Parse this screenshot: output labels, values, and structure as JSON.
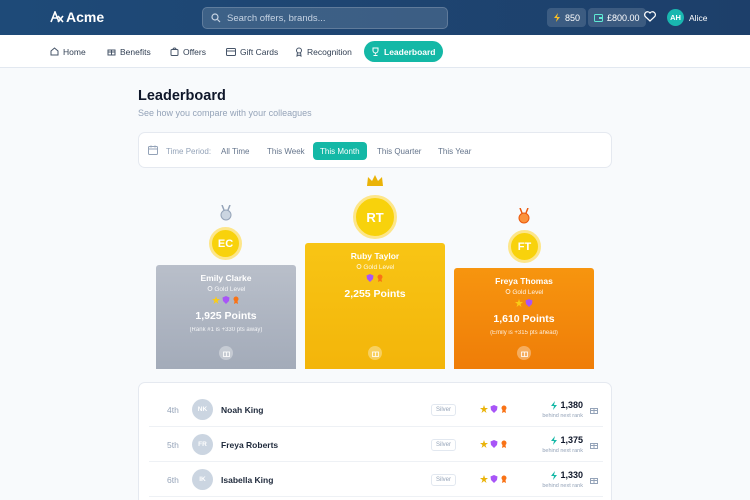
{
  "header": {
    "brand": "Acme",
    "search_placeholder": "Search offers, brands...",
    "points_balance": "850",
    "wallet_balance": "£800.00",
    "user_initials": "AH",
    "user_name": "Alice"
  },
  "nav": {
    "items": [
      {
        "label": "Home",
        "icon": "home-icon"
      },
      {
        "label": "Benefits",
        "icon": "gift-icon"
      },
      {
        "label": "Offers",
        "icon": "shopping-bag-icon"
      },
      {
        "label": "Gift Cards",
        "icon": "card-icon"
      },
      {
        "label": "Recognition",
        "icon": "award-icon"
      },
      {
        "label": "Leaderboard",
        "icon": "trophy-icon",
        "active": true
      }
    ]
  },
  "page": {
    "title": "Leaderboard",
    "subtitle": "See how you compare with your colleagues"
  },
  "filter": {
    "label": "Time Period:",
    "options": [
      "All Time",
      "This Week",
      "This Month",
      "This Quarter",
      "This Year"
    ],
    "selected": "This Month"
  },
  "podium": {
    "first": {
      "initials": "RT",
      "name": "Ruby Taylor",
      "level": "Gold Level",
      "points": "2,255 Points",
      "color": "#f5b90a"
    },
    "second": {
      "initials": "EC",
      "name": "Emily Clarke",
      "level": "Gold Level",
      "points": "1,925 Points",
      "note": "(Rank #1 is +330 pts away)",
      "color": "#aeb5c2"
    },
    "third": {
      "initials": "FT",
      "name": "Freya Thomas",
      "level": "Gold Level",
      "points": "1,610 Points",
      "note": "(Emily is +315 pts ahead)",
      "color": "#f28a0c"
    }
  },
  "list": {
    "rows": [
      {
        "rank": "4th",
        "initials": "NK",
        "name": "Noah King",
        "tier": "Silver",
        "points": "1,380",
        "note": "behind next rank"
      },
      {
        "rank": "5th",
        "initials": "FR",
        "name": "Freya Roberts",
        "tier": "Silver",
        "points": "1,375",
        "note": "behind next rank"
      },
      {
        "rank": "6th",
        "initials": "IK",
        "name": "Isabella King",
        "tier": "Silver",
        "points": "1,330",
        "note": "behind next rank"
      }
    ]
  },
  "colors": {
    "accent": "#14b8a6",
    "header": "#1e4a78"
  }
}
